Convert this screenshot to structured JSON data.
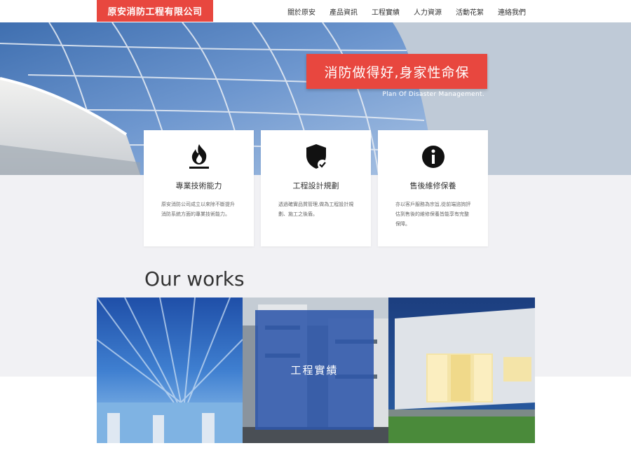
{
  "header": {
    "logo": "原安消防工程有限公司",
    "nav": [
      "關於原安",
      "產品資訊",
      "工程實績",
      "人力資源",
      "活動花絮",
      "連絡我們"
    ]
  },
  "hero": {
    "tagline": "消防做得好,身家性命保",
    "subtitle": "Plan Of Disaster Management."
  },
  "features": [
    {
      "icon": "fire-icon",
      "title": "專業技術能力",
      "desc": "原安消防公司成立以來除不斷提升消防系統方面的專業技術能力。"
    },
    {
      "icon": "shield-check-icon",
      "title": "工程設計規劃",
      "desc": "透過確實品質管理,做為工程設計規劃、施工之後盾。"
    },
    {
      "icon": "info-icon",
      "title": "售後維修保養",
      "desc": "亦以客戶服務為宗旨,從前端諮詢評估到售後的維修保養皆能享有完整保障。"
    }
  ],
  "works": {
    "title": "Our works",
    "overlay_label": "工程實績"
  },
  "colors": {
    "accent": "#e8473f",
    "overlay": "#2d56aa"
  }
}
